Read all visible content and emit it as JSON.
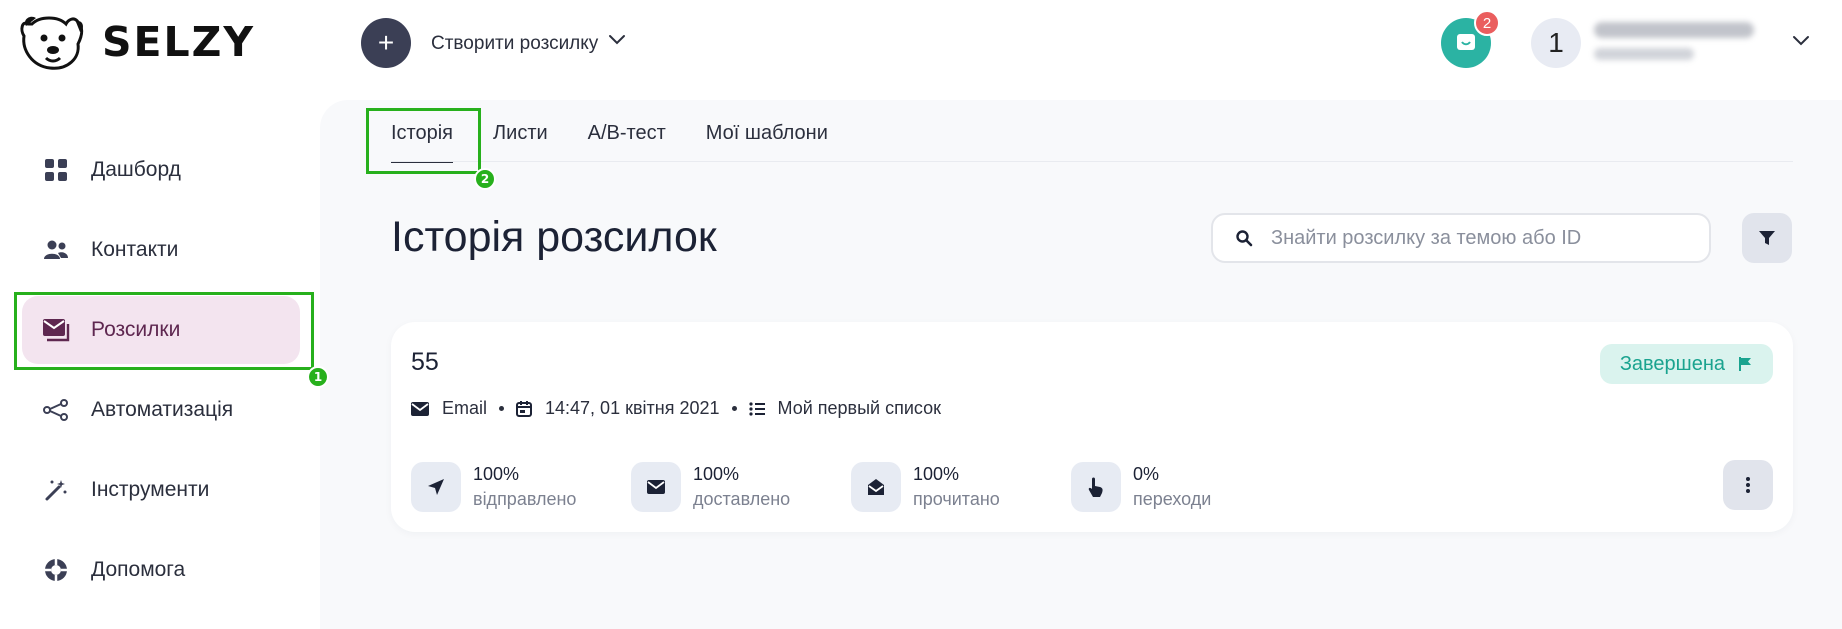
{
  "brand": {
    "name": "SELZY"
  },
  "header": {
    "create_label": "Створити розсилку",
    "chat_badge": "2",
    "avatar_initial": "1"
  },
  "sidebar": {
    "items": [
      {
        "label": "Дашборд",
        "icon": "dashboard-grid-icon",
        "active": false
      },
      {
        "label": "Контакти",
        "icon": "contacts-people-icon",
        "active": false
      },
      {
        "label": "Розсилки",
        "icon": "mailing-envelope-icon",
        "active": true
      },
      {
        "label": "Автоматизація",
        "icon": "automation-nodes-icon",
        "active": false
      },
      {
        "label": "Інструменти",
        "icon": "magic-wand-icon",
        "active": false
      },
      {
        "label": "Допомога",
        "icon": "lifebuoy-icon",
        "active": false
      }
    ]
  },
  "tabs": [
    {
      "label": "Історія",
      "active": true
    },
    {
      "label": "Листи",
      "active": false
    },
    {
      "label": "А/В-тест",
      "active": false
    },
    {
      "label": "Мої шаблони",
      "active": false
    }
  ],
  "page": {
    "title": "Історія розсилок",
    "search_placeholder": "Знайти розсилку за темою або ID"
  },
  "campaign": {
    "title": "55",
    "status": "Завершена",
    "channel": "Email",
    "datetime": "14:47, 01 квітня 2021",
    "list_name": "Мой первый список",
    "stats": [
      {
        "value": "100%",
        "label": "відправлено",
        "icon": "send-arrow-icon"
      },
      {
        "value": "100%",
        "label": "доставлено",
        "icon": "envelope-closed-icon"
      },
      {
        "value": "100%",
        "label": "прочитано",
        "icon": "envelope-open-icon"
      },
      {
        "value": "0%",
        "label": "переходи",
        "icon": "pointer-hand-icon"
      }
    ]
  },
  "annotations": [
    {
      "number": "1",
      "target": "sidebar-item-mailings"
    },
    {
      "number": "2",
      "target": "tab-history"
    }
  ],
  "colors": {
    "accent_teal": "#2bb3a3",
    "active_nav_bg": "#f3e4ef",
    "status_bg": "#daf3ee",
    "status_text": "#1aa38f",
    "annotation_green": "#27b01c",
    "badge_red": "#ea5e5e"
  }
}
